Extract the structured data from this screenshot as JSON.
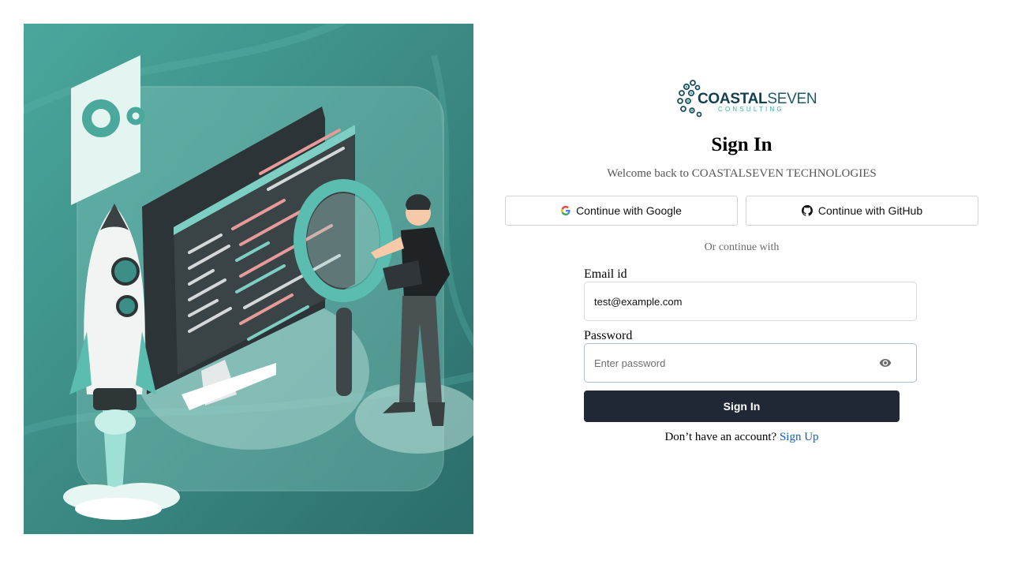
{
  "brand": {
    "name_bold": "COASTAL",
    "name_light": "SEVEN",
    "tagline": "CONSULTING"
  },
  "heading": "Sign In",
  "subheading": "Welcome back to COASTALSEVEN TECHNOLOGIES",
  "oauth": {
    "google_label": "Continue with Google",
    "google_icon": "google-g-icon",
    "github_label": "Continue with GitHub",
    "github_icon": "github-icon"
  },
  "divider_label": "Or continue with",
  "form": {
    "email_label": "Email id",
    "email_value": "test@example.com",
    "password_label": "Password",
    "password_placeholder": "Enter password",
    "password_toggle_icon": "eye-icon",
    "submit_label": "Sign In"
  },
  "footer": {
    "prompt": "Don’t have an account?",
    "link_label": "Sign Up"
  },
  "colors": {
    "button_bg": "#202835",
    "link": "#1061b5",
    "teal": "#3f9b91"
  }
}
